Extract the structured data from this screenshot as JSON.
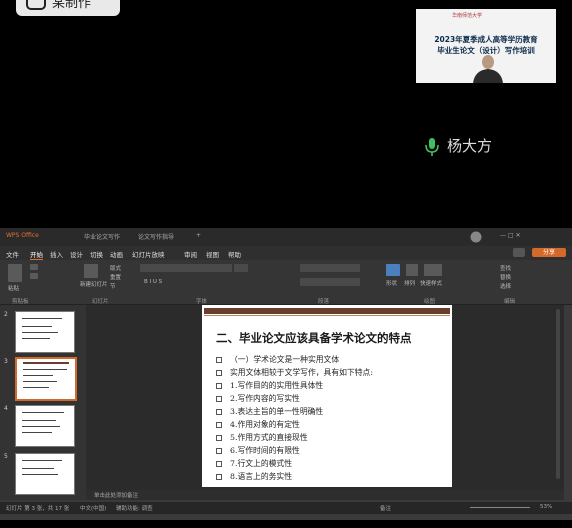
{
  "overlay": {
    "label": "某制作"
  },
  "video": {
    "logo_text": "华南师范大学",
    "line1": "2023年夏季成人高等学历教育",
    "line2": "毕业生论文（设计）写作培训"
  },
  "participant": {
    "name": "杨大方"
  },
  "app": {
    "title_tabs": [
      "WPS Office",
      "毕业论文写作",
      "论文写作指导",
      "+"
    ],
    "menus": [
      "文件",
      "开始",
      "插入",
      "设计",
      "切换",
      "动画",
      "幻灯片放映",
      "审阅",
      "视图",
      "帮助"
    ],
    "active_menu": "开始",
    "share_label": "分享",
    "ribbon_groups": [
      "剪贴板",
      "幻灯片",
      "字体",
      "段落",
      "绘图",
      "编辑"
    ],
    "ribbon_labels": {
      "paste": "粘贴",
      "new_slide": "新建幻灯片",
      "layout": "版式",
      "reset": "重置",
      "section": "节",
      "shape": "形状",
      "arrange": "排列",
      "quick_style": "快速样式",
      "find": "查找",
      "replace": "替换",
      "select": "选择"
    },
    "notes_placeholder": "单击此处添加备注",
    "status": {
      "slide_info": "幻灯片 第 3 张，共 17 张",
      "language": "中文(中国)",
      "accessibility": "辅助功能: 调查",
      "notes": "备注",
      "zoom": "53%"
    }
  },
  "thumbnails": [
    {
      "num": "2"
    },
    {
      "num": "3",
      "selected": true
    },
    {
      "num": "4"
    },
    {
      "num": "5"
    }
  ],
  "slide": {
    "title": "二、毕业论文应该具备学术论文的特点",
    "bullets": [
      "（一）学术论文是一种实用文体",
      "实用文体相较于文学写作，具有如下特点:",
      "1.写作目的的实用性具体性",
      "2.写作内容的写实性",
      "3.表达主旨的单一性明确性",
      "4.作用对象的有定性",
      "5.作用方式的直接现性",
      "6.写作时间的有限性",
      "7.行文上的模式性",
      "8.语言上的务实性"
    ]
  }
}
